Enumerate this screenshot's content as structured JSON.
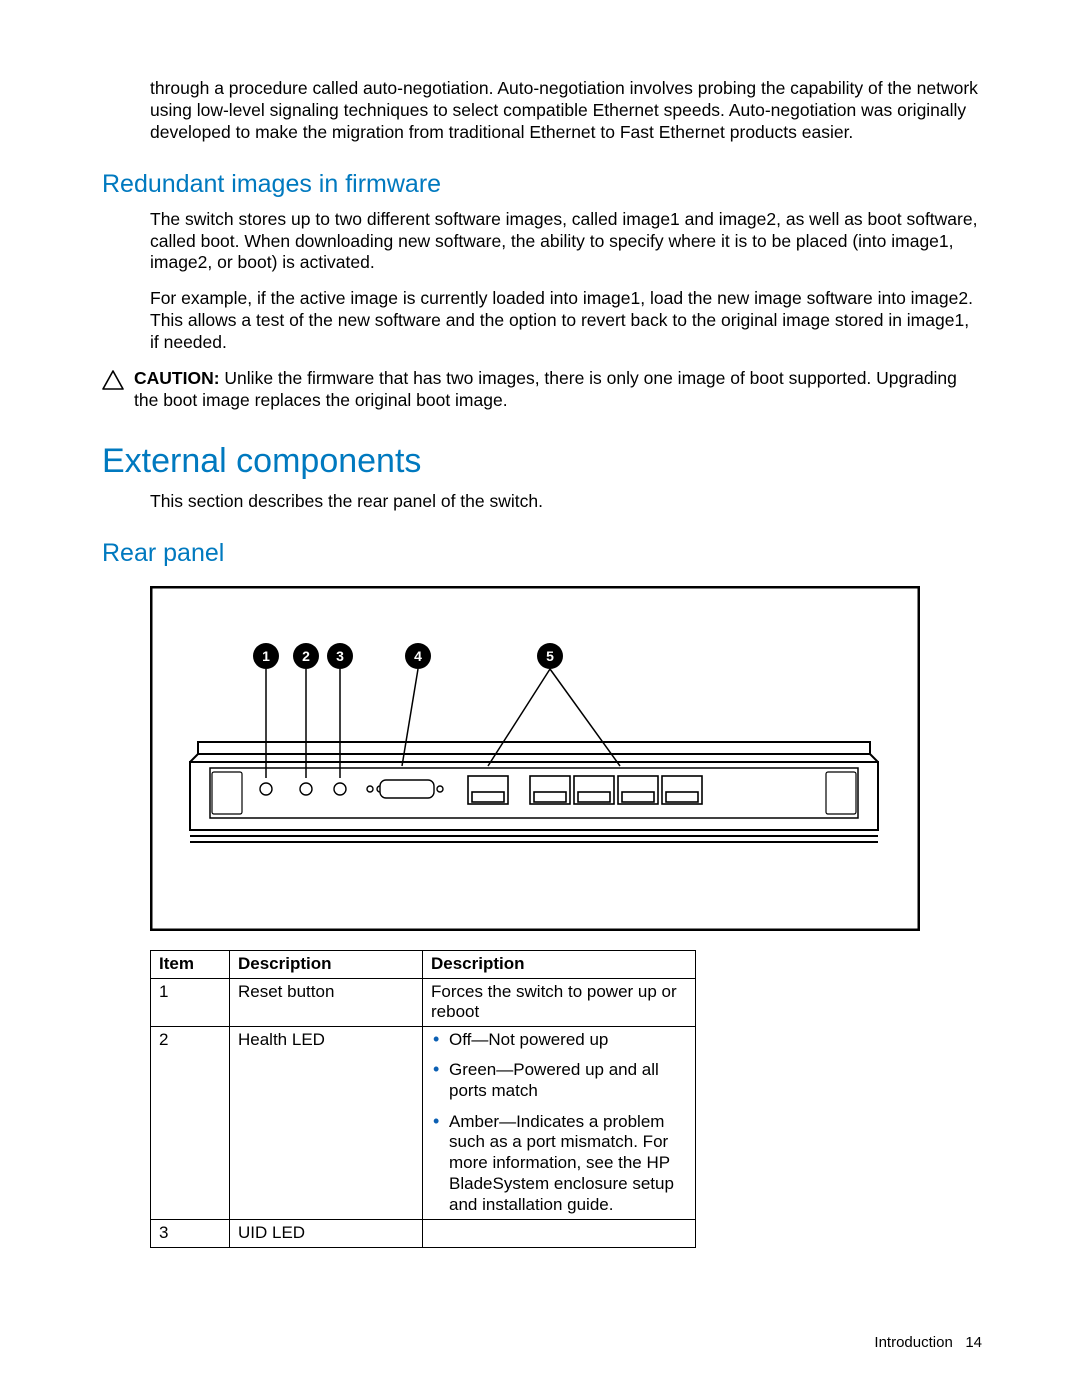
{
  "intro_para": "through a procedure called auto-negotiation. Auto-negotiation involves probing the capability of the network using low-level signaling techniques to select compatible Ethernet speeds. Auto-negotiation was originally developed to make the migration from traditional Ethernet to Fast Ethernet products easier.",
  "sec1": {
    "title": "Redundant images in firmware",
    "p1": "The switch stores up to two different software images, called image1 and image2, as well as boot software, called boot. When downloading new software, the ability to specify where it is to be placed (into image1, image2, or boot) is activated.",
    "p2": "For example, if the active image is currently loaded into image1, load the new image software into image2. This allows a test of the new software and the option to revert back to the original image stored in image1, if needed."
  },
  "caution": {
    "label": "CAUTION:",
    "text": "Unlike the firmware that has two images, there is only one image of boot supported. Upgrading the boot image replaces the original boot image."
  },
  "sec2": {
    "title": "External components",
    "p1": "This section describes the rear panel of the switch."
  },
  "sec3": {
    "title": "Rear panel"
  },
  "callouts": [
    "1",
    "2",
    "3",
    "4",
    "5"
  ],
  "table": {
    "headers": [
      "Item",
      "Description",
      "Description"
    ],
    "rows": [
      {
        "item": "1",
        "desc1": "Reset button",
        "desc2_text": "Forces the switch to power up or reboot"
      },
      {
        "item": "2",
        "desc1": "Health LED",
        "desc2_list": [
          "Off—Not powered up",
          "Green—Powered up and all ports match",
          "Amber—Indicates a problem such as a port mismatch. For more information, see the HP BladeSystem enclosure setup and installation guide."
        ]
      },
      {
        "item": "3",
        "desc1": "UID LED",
        "desc2_text": ""
      }
    ]
  },
  "footer": {
    "section": "Introduction",
    "page": "14"
  },
  "colors": {
    "accent": "#0079bf"
  }
}
